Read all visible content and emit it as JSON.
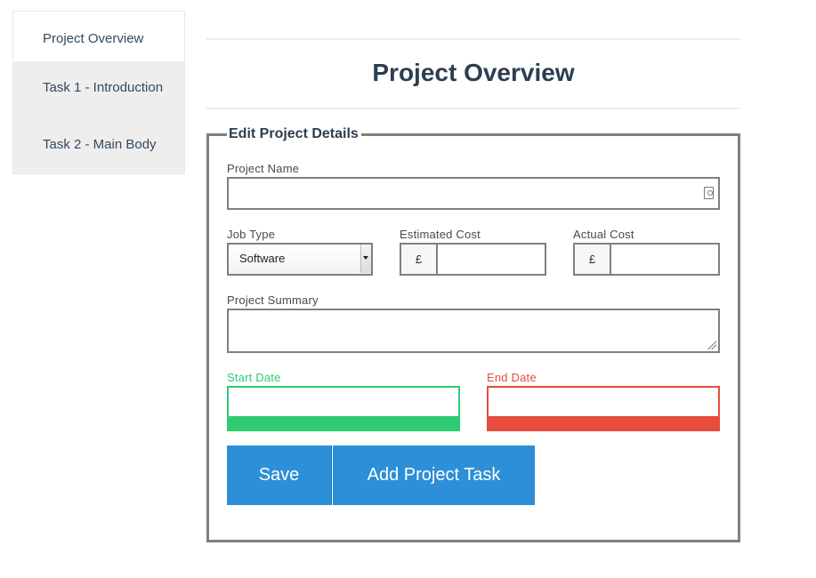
{
  "sidebar": {
    "items": [
      {
        "label": "Project Overview",
        "active": true
      },
      {
        "label": "Task 1 - Introduction",
        "active": false
      },
      {
        "label": "Task 2 - Main Body",
        "active": false
      }
    ]
  },
  "main": {
    "title": "Project Overview"
  },
  "form": {
    "legend": "Edit Project Details",
    "project_name": {
      "label": "Project Name",
      "value": "",
      "icon": "contact-card-icon"
    },
    "job_type": {
      "label": "Job Type",
      "selected": "Software"
    },
    "estimated_cost": {
      "label": "Estimated Cost",
      "currency": "£",
      "value": ""
    },
    "actual_cost": {
      "label": "Actual Cost",
      "currency": "£",
      "value": ""
    },
    "project_summary": {
      "label": "Project Summary",
      "value": ""
    },
    "start_date": {
      "label": "Start Date",
      "value": "",
      "color": "#2ecc71"
    },
    "end_date": {
      "label": "End Date",
      "value": "",
      "color": "#e74c3c"
    },
    "buttons": {
      "save_label": "Save",
      "add_task_label": "Add Project Task",
      "color": "#2c8fd8"
    }
  }
}
